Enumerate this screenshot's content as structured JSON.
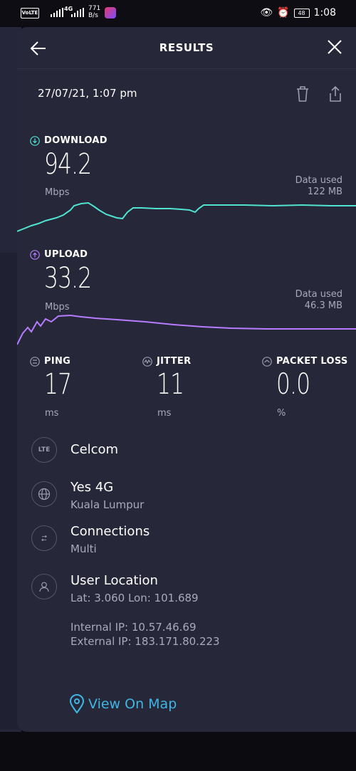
{
  "status_bar": {
    "network_label": "VoLTE",
    "network_type": "4G",
    "speed_value": "771",
    "speed_unit": "B/s",
    "battery": "48",
    "time": "1:08"
  },
  "header": {
    "title": "RESULTS"
  },
  "test": {
    "date": "27/07/21, 1:07 pm"
  },
  "download": {
    "label": "DOWNLOAD",
    "value": "94.2",
    "unit": "Mbps",
    "data_used_label": "Data used",
    "data_used": "122 MB",
    "color": "#4fe3d0"
  },
  "upload": {
    "label": "UPLOAD",
    "value": "33.2",
    "unit": "Mbps",
    "data_used_label": "Data used",
    "data_used": "46.3 MB",
    "color": "#b77cff"
  },
  "ping": {
    "label": "PING",
    "value": "17",
    "unit": "ms"
  },
  "jitter": {
    "label": "JITTER",
    "value": "11",
    "unit": "ms"
  },
  "packet_loss": {
    "label": "PACKET LOSS",
    "value": "0.0",
    "unit": "%"
  },
  "provider": {
    "badge": "LTE",
    "name": "Celcom"
  },
  "server": {
    "name": "Yes 4G",
    "location": "Kuala Lumpur"
  },
  "connections": {
    "title": "Connections",
    "value": "Multi"
  },
  "user_location": {
    "title": "User Location",
    "coords": "Lat: 3.060 Lon: 101.689",
    "internal_ip": "Internal IP: 10.57.46.69",
    "external_ip": "External IP: 183.171.80.223"
  },
  "map_link": {
    "label": "View On Map"
  },
  "icons": [
    "back-arrow-icon",
    "close-icon",
    "trash-icon",
    "share-icon",
    "download-icon",
    "upload-icon",
    "ping-icon",
    "jitter-icon",
    "packet-loss-icon",
    "globe-icon",
    "connections-icon",
    "user-icon",
    "map-pin-icon"
  ]
}
